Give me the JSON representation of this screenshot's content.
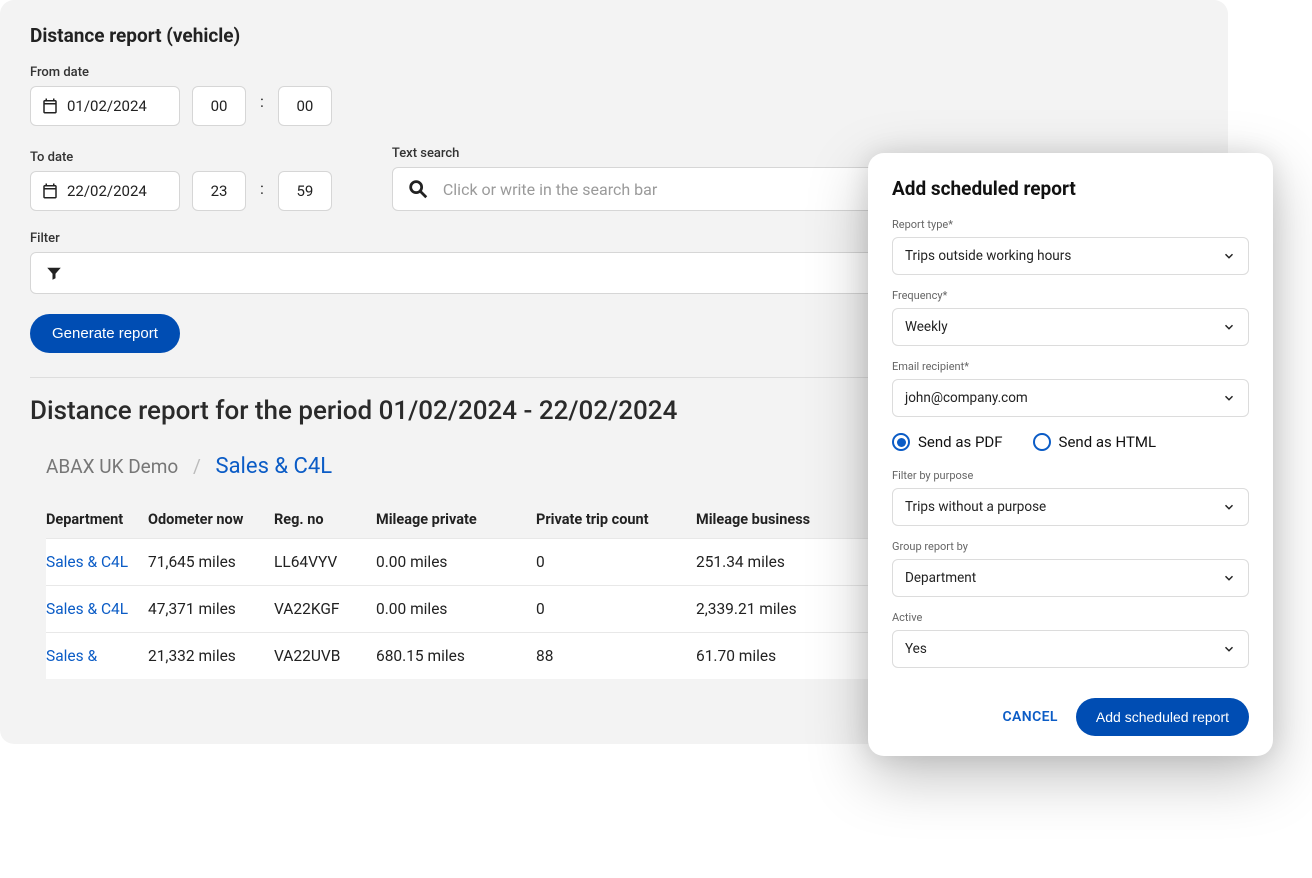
{
  "page": {
    "title": "Distance report (vehicle)",
    "from_label": "From date",
    "from_date": "01/02/2024",
    "from_hh": "00",
    "from_mm": "00",
    "to_label": "To date",
    "to_date": "22/02/2024",
    "to_hh": "23",
    "to_mm": "59",
    "search_label": "Text search",
    "search_placeholder": "Click or write in the search bar",
    "filter_label": "Filter",
    "generate_label": "Generate report",
    "result_heading": "Distance report for the period 01/02/2024 - 22/02/2024",
    "breadcrumb_root": "ABAX UK Demo",
    "breadcrumb_leaf": "Sales & C4L"
  },
  "columns": {
    "dept": "Department",
    "odo": "Odometer now",
    "reg": "Reg. no",
    "mpriv": "Mileage private",
    "pcnt": "Private trip count",
    "mbiz": "Mileage business"
  },
  "rows": [
    {
      "dept": "Sales & C4L",
      "odo": "71,645 miles",
      "reg": "LL64VYV",
      "mpriv": "0.00 miles",
      "pcnt": "0",
      "mbiz": "251.34 miles"
    },
    {
      "dept": "Sales & C4L",
      "odo": "47,371 miles",
      "reg": "VA22KGF",
      "mpriv": "0.00 miles",
      "pcnt": "0",
      "mbiz": "2,339.21 miles"
    },
    {
      "dept": "Sales &",
      "odo": "21,332 miles",
      "reg": "VA22UVB",
      "mpriv": "680.15 miles",
      "pcnt": "88",
      "mbiz": "61.70 miles"
    }
  ],
  "modal": {
    "title": "Add scheduled report",
    "report_type_label": "Report type*",
    "report_type_value": "Trips outside working hours",
    "frequency_label": "Frequency*",
    "frequency_value": "Weekly",
    "email_label": "Email recipient*",
    "email_value": "john@company.com",
    "radio_pdf": "Send as PDF",
    "radio_html": "Send as HTML",
    "purpose_label": "Filter by purpose",
    "purpose_value": "Trips without a purpose",
    "group_label": "Group report by",
    "group_value": "Department",
    "active_label": "Active",
    "active_value": "Yes",
    "cancel": "CANCEL",
    "submit": "Add scheduled report"
  }
}
